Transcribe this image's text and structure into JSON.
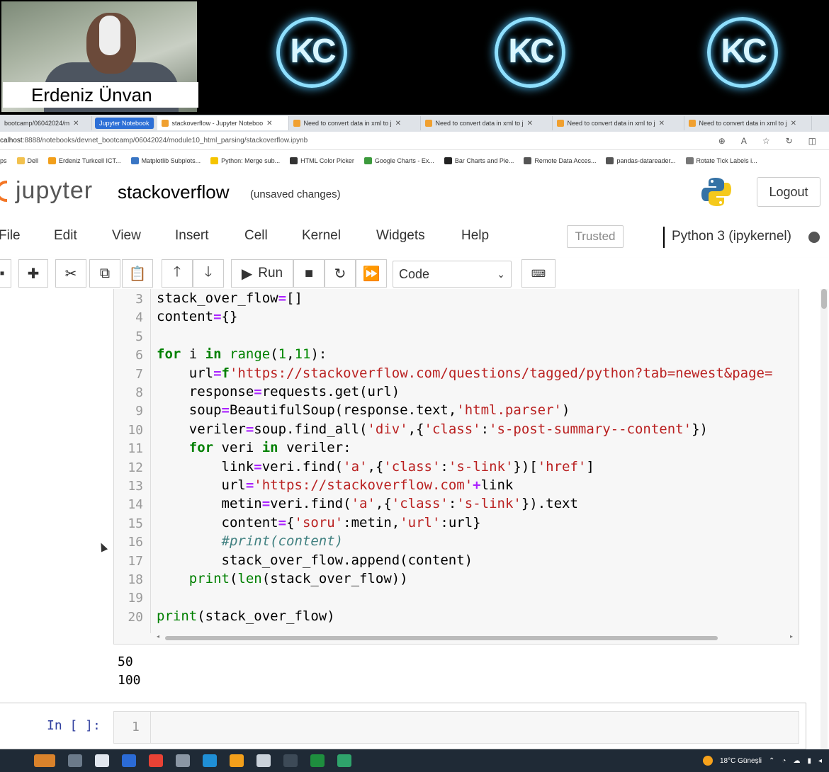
{
  "video": {
    "participant_name": "Erdeniz Ünvan",
    "logo_text": "KC"
  },
  "browser": {
    "tabs": [
      {
        "label": "bootcamp/06042024/m"
      },
      {
        "label": "Jupyter Notebook"
      },
      {
        "label": "stackoverflow - Jupyter Noteboo"
      },
      {
        "label": "Need to convert data in xml to j"
      },
      {
        "label": "Need to convert data in xml to j"
      },
      {
        "label": "Need to convert data in xml to j"
      },
      {
        "label": "Need to convert data in xml to j"
      }
    ],
    "url_host": "calhost",
    "url_rest": ":8888/notebooks/devnet_bootcamp/06042024/module10_html_parsing/stackoverflow.ipynb",
    "bookmarks": [
      {
        "label": "ps",
        "color": "#ffffff"
      },
      {
        "label": "Dell",
        "color": "#f2c14e"
      },
      {
        "label": "Erdeniz Turkcell ICT...",
        "color": "#f29f1b"
      },
      {
        "label": "Matplotlib Subplots...",
        "color": "#3a76c4"
      },
      {
        "label": "Python: Merge sub...",
        "color": "#f5c400"
      },
      {
        "label": "HTML Color Picker",
        "color": "#333333"
      },
      {
        "label": "Google Charts - Ex...",
        "color": "#3c9a3c"
      },
      {
        "label": "Bar Charts and Pie...",
        "color": "#222222"
      },
      {
        "label": "Remote Data Acces...",
        "color": "#555555"
      },
      {
        "label": "pandas-datareader...",
        "color": "#555555"
      },
      {
        "label": "Rotate Tick Labels i...",
        "color": "#777777"
      }
    ]
  },
  "jupyter": {
    "logo_text": "jupyter",
    "notebook_name": "stackoverflow",
    "save_status": "(unsaved changes)",
    "logout_label": "Logout",
    "menu": [
      "File",
      "Edit",
      "View",
      "Insert",
      "Cell",
      "Kernel",
      "Widgets",
      "Help"
    ],
    "trusted_label": "Trusted",
    "kernel_name": "Python 3 (ipykernel)",
    "run_label": "Run",
    "cell_type": "Code"
  },
  "code": {
    "line_numbers": [
      "3",
      "4",
      "5",
      "6",
      "7",
      "8",
      "9",
      "10",
      "11",
      "12",
      "13",
      "14",
      "15",
      "16",
      "17",
      "18",
      "19",
      "20"
    ],
    "lines": [
      "stack_over_flow=[]",
      "content={}",
      "",
      "for i in range(1,11):",
      "    url=f'https://stackoverflow.com/questions/tagged/python?tab=newest&page=",
      "    response=requests.get(url)",
      "    soup=BeautifulSoup(response.text,'html.parser')",
      "    veriler=soup.find_all('div',{'class':'s-post-summary--content'})",
      "    for veri in veriler:",
      "        link=veri.find('a',{'class':'s-link'})['href']",
      "        url='https://stackoverflow.com'+link",
      "        metin=veri.find('a',{'class':'s-link'}).text",
      "        content={'soru':metin,'url':url}",
      "        #print(content)",
      "        stack_over_flow.append(content)",
      "    print(len(stack_over_flow))",
      "",
      "print(stack_over_flow)"
    ]
  },
  "output": [
    "50",
    "100"
  ],
  "empty_cell": {
    "prompt": "In [ ]:",
    "line_number": "1"
  },
  "taskbar": {
    "weather": "18°C Güneşli"
  }
}
